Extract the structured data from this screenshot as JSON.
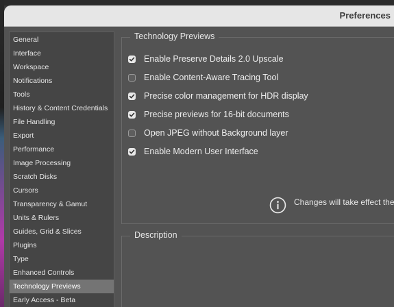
{
  "window": {
    "title": "Preferences"
  },
  "sidebar": {
    "items": [
      {
        "label": "General",
        "selected": false
      },
      {
        "label": "Interface",
        "selected": false
      },
      {
        "label": "Workspace",
        "selected": false
      },
      {
        "label": "Notifications",
        "selected": false
      },
      {
        "label": "Tools",
        "selected": false
      },
      {
        "label": "History & Content Credentials",
        "selected": false
      },
      {
        "label": "File Handling",
        "selected": false
      },
      {
        "label": "Export",
        "selected": false
      },
      {
        "label": "Performance",
        "selected": false
      },
      {
        "label": "Image Processing",
        "selected": false
      },
      {
        "label": "Scratch Disks",
        "selected": false
      },
      {
        "label": "Cursors",
        "selected": false
      },
      {
        "label": "Transparency & Gamut",
        "selected": false
      },
      {
        "label": "Units & Rulers",
        "selected": false
      },
      {
        "label": "Guides, Grid & Slices",
        "selected": false
      },
      {
        "label": "Plugins",
        "selected": false
      },
      {
        "label": "Type",
        "selected": false
      },
      {
        "label": "Enhanced Controls",
        "selected": false
      },
      {
        "label": "Technology Previews",
        "selected": true
      },
      {
        "label": "Early Access - Beta",
        "selected": false
      }
    ]
  },
  "tech_previews": {
    "heading": "Technology Previews",
    "options": [
      {
        "label": "Enable Preserve Details 2.0 Upscale",
        "checked": true
      },
      {
        "label": "Enable Content-Aware Tracing Tool",
        "checked": false
      },
      {
        "label": "Precise color management for HDR display",
        "checked": true
      },
      {
        "label": "Precise previews for 16-bit documents",
        "checked": true
      },
      {
        "label": "Open JPEG without Background layer",
        "checked": false
      },
      {
        "label": "Enable Modern User Interface",
        "checked": true
      }
    ],
    "notice": "Changes will take effect the next time you start Photoshop."
  },
  "description": {
    "heading": "Description"
  },
  "icons": {
    "info": "info-circle-icon",
    "check": "checkmark-icon"
  },
  "colors": {
    "selected_item": "#747474",
    "checkbox_checked": "#e8e8e8"
  }
}
